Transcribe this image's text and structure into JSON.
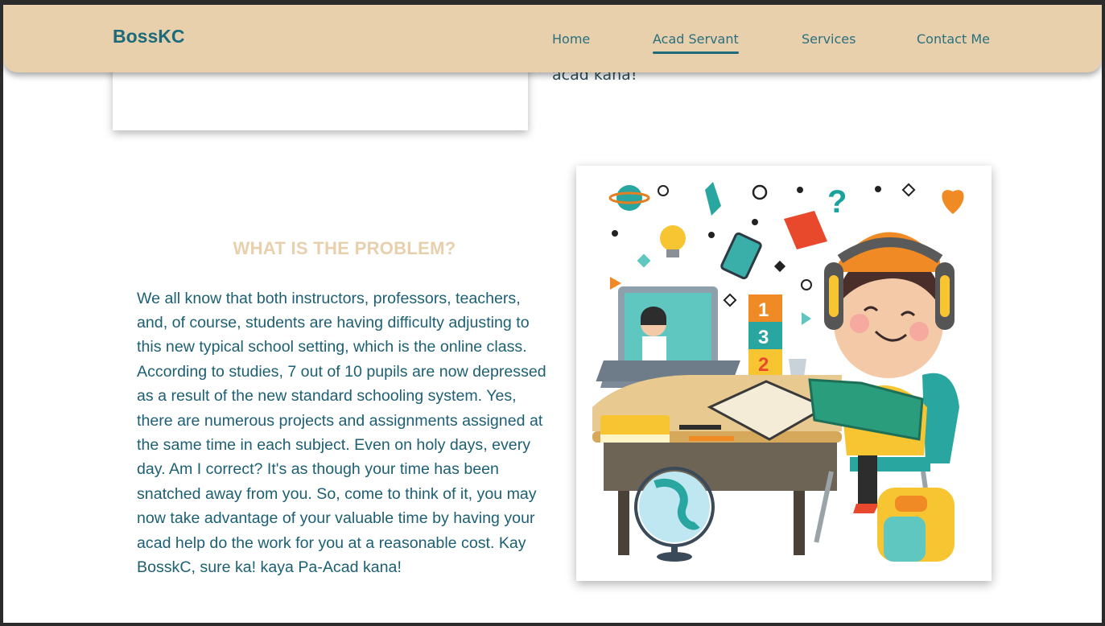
{
  "navbar": {
    "brand": "BossKC",
    "links": [
      {
        "label": "Home",
        "active": false
      },
      {
        "label": "Acad Servant",
        "active": true
      },
      {
        "label": "Services",
        "active": false
      },
      {
        "label": "Contact Me",
        "active": false
      }
    ]
  },
  "previous_section": {
    "trailing_text": "acad kana!"
  },
  "problem": {
    "title": "WHAT IS THE PROBLEM?",
    "body": "We all know that both instructors, professors, teachers, and, of course, students are having difficulty adjusting to this new typical school setting, which is the online class. According to studies, 7 out of 10 pupils are now depressed as a result of the new standard schooling system. Yes, there are numerous projects and assignments assigned at the same time in each subject. Even on holy days, every day. Am I correct? It's as though your time has been snatched away from you. So, come to think of it, you may now take advantage of your valuable time by having your acad help do the work for you at a reasonable cost. Kay BosskC, sure ka! kaya Pa-Acad kana!",
    "illustration": "girl-studying-online-illustration"
  },
  "colors": {
    "navbar_bg": "#e8d0ad",
    "brand": "#1c6a7a",
    "heading": "#e8d0ad",
    "body_text": "#1d6073"
  }
}
